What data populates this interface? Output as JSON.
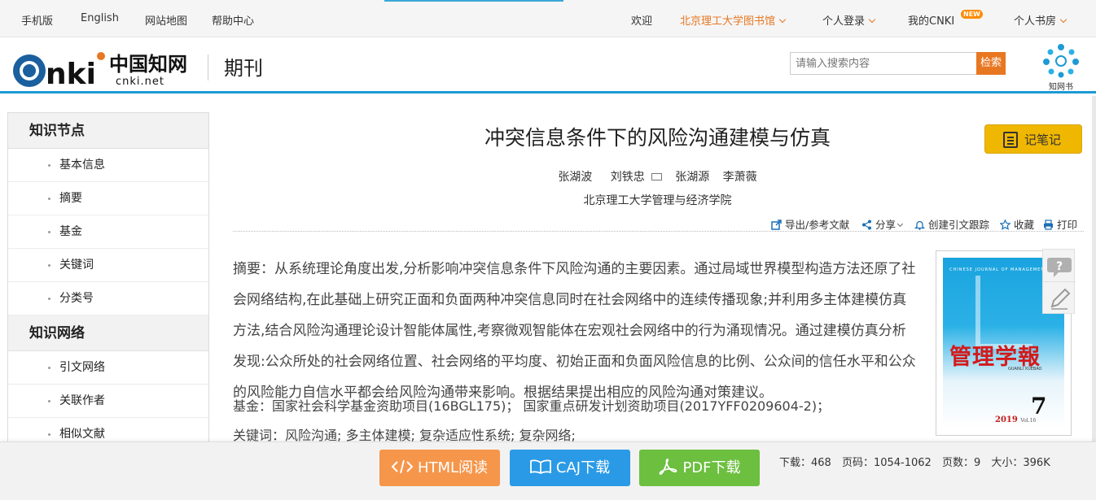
{
  "topbar": {
    "left_links": [
      "手机版",
      "English",
      "网站地图",
      "帮助中心"
    ],
    "welcome": "欢迎",
    "institution": "北京理工大学图书馆",
    "login": "个人登录",
    "my_cnki": "我的CNKI",
    "new_badge": "NEW",
    "bookroom": "个人书房"
  },
  "header": {
    "logo_cn": "中国知网",
    "logo_url_text": "cnki.net",
    "section": "期刊",
    "search_placeholder": "请输入搜索内容",
    "search_button": "检索",
    "zhiwang_caption": "知网书"
  },
  "sidebar": {
    "groups": [
      {
        "title": "知识节点",
        "items": [
          "基本信息",
          "摘要",
          "基金",
          "关键词",
          "分类号"
        ]
      },
      {
        "title": "知识网络",
        "items": [
          "引文网络",
          "关联作者",
          "相似文献"
        ]
      }
    ]
  },
  "article": {
    "title": "冲突信息条件下的风险沟通建模与仿真",
    "note_button": "记笔记",
    "authors": [
      "张湖波",
      "刘铁忠",
      "张湖源",
      "李萧薇"
    ],
    "affiliation": "北京理工大学管理与经济学院",
    "tools": [
      "导出/参考文献",
      "分享",
      "创建引文跟踪",
      "收藏",
      "打印"
    ],
    "abstract_label": "摘要：",
    "abstract": "从系统理论角度出发,分析影响冲突信息条件下风险沟通的主要因素。通过局域世界模型构造方法还原了社会网络结构,在此基础上研究正面和负面两种冲突信息同时在社会网络中的连续传播现象;并利用多主体建模仿真方法,结合风险沟通理论设计智能体属性,考察微观智能体在宏观社会网络中的行为涌现情况。通过建模仿真分析发现:公众所处的社会网络位置、社会网络的平均度、初始正面和负面风险信息的比例、公众间的信任水平和公众的风险能力自信水平都会给风险沟通带来影响。根据结果提出相应的风险沟通对策建议。",
    "fund_label": "基金：",
    "fund": "国家社会科学基金资助项目(16BGL175)；  国家重点研发计划资助项目(2017YFF0209604-2)；",
    "keywords_label": "关键词：",
    "keywords": "风险沟通; 多主体建模; 复杂适应性系统; 复杂网络;"
  },
  "cover": {
    "journal_en": "CHINESE JOURNAL OF MANAGEMENT",
    "journal_zh": "管理学報",
    "pinyin": "GUANLI XUEBAO",
    "issue": "7",
    "year": "2019",
    "vol": "Vol.16"
  },
  "downloads": {
    "html": "HTML阅读",
    "caj": "CAJ下载",
    "pdf": "PDF下载"
  },
  "stats": {
    "downloads": "下载：468",
    "pages": "页码：1054-1062",
    "page_count": "页数：9",
    "size": "大小：396K"
  },
  "colors": {
    "accent_blue": "#1c9ad6",
    "orange": "#e87722",
    "note_yellow": "#f0b700",
    "html_btn": "#f5964b",
    "caj_btn": "#2a9ae6",
    "pdf_btn": "#6cbf3f"
  }
}
